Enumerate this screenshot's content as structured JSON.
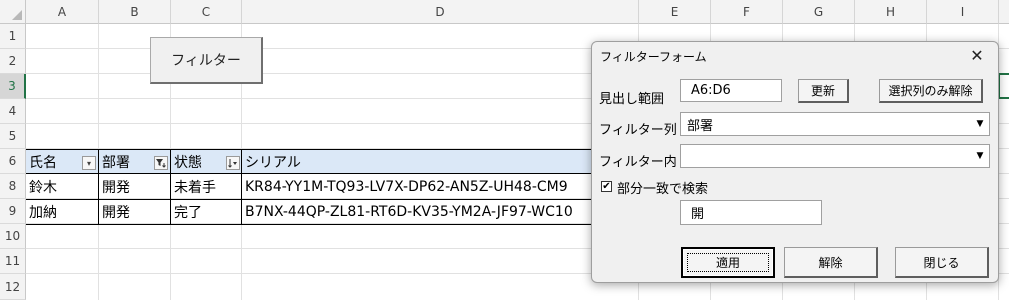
{
  "columns": [
    "A",
    "B",
    "C",
    "D",
    "E",
    "F",
    "G",
    "H",
    "I"
  ],
  "rows": [
    "1",
    "2",
    "3",
    "4",
    "5",
    "6",
    "8",
    "9",
    "10",
    "11",
    "12"
  ],
  "sheet_button": "フィルター",
  "table": {
    "headers": [
      "氏名",
      "部署",
      "状態",
      "シリアル"
    ],
    "data": [
      [
        "鈴木",
        "開発",
        "未着手",
        "KR84-YY1M-TQ93-LV7X-DP62-AN5Z-UH48-CM9"
      ],
      [
        "加納",
        "開発",
        "完了",
        "B7NX-44QP-ZL81-RT6D-KV35-YM2A-JF97-WC10"
      ]
    ]
  },
  "icons": {
    "col_a_filter": "dropdown-arrow-icon",
    "col_b_filter": "filter-applied-icon",
    "col_c_filter": "sort-filter-icon"
  },
  "dialog": {
    "title": "フィルターフォーム",
    "close": "✕",
    "range_label": "見出し範囲",
    "range_value": "A6:D6",
    "update_button": "更新",
    "clear_selected_button": "選択列のみ解除",
    "filter_column_label": "フィルター列",
    "filter_column_value": "部署",
    "filter_value_label": "フィルター内",
    "filter_value_value": "",
    "partial_match_label": "部分一致で検索",
    "partial_match_checked": "✔",
    "search_text": "開",
    "apply_button": "適用",
    "clear_button": "解除",
    "close_button": "閉じる"
  },
  "colors": {
    "header_fill": "#dbe8f7",
    "selected_row_header": "#217346"
  }
}
